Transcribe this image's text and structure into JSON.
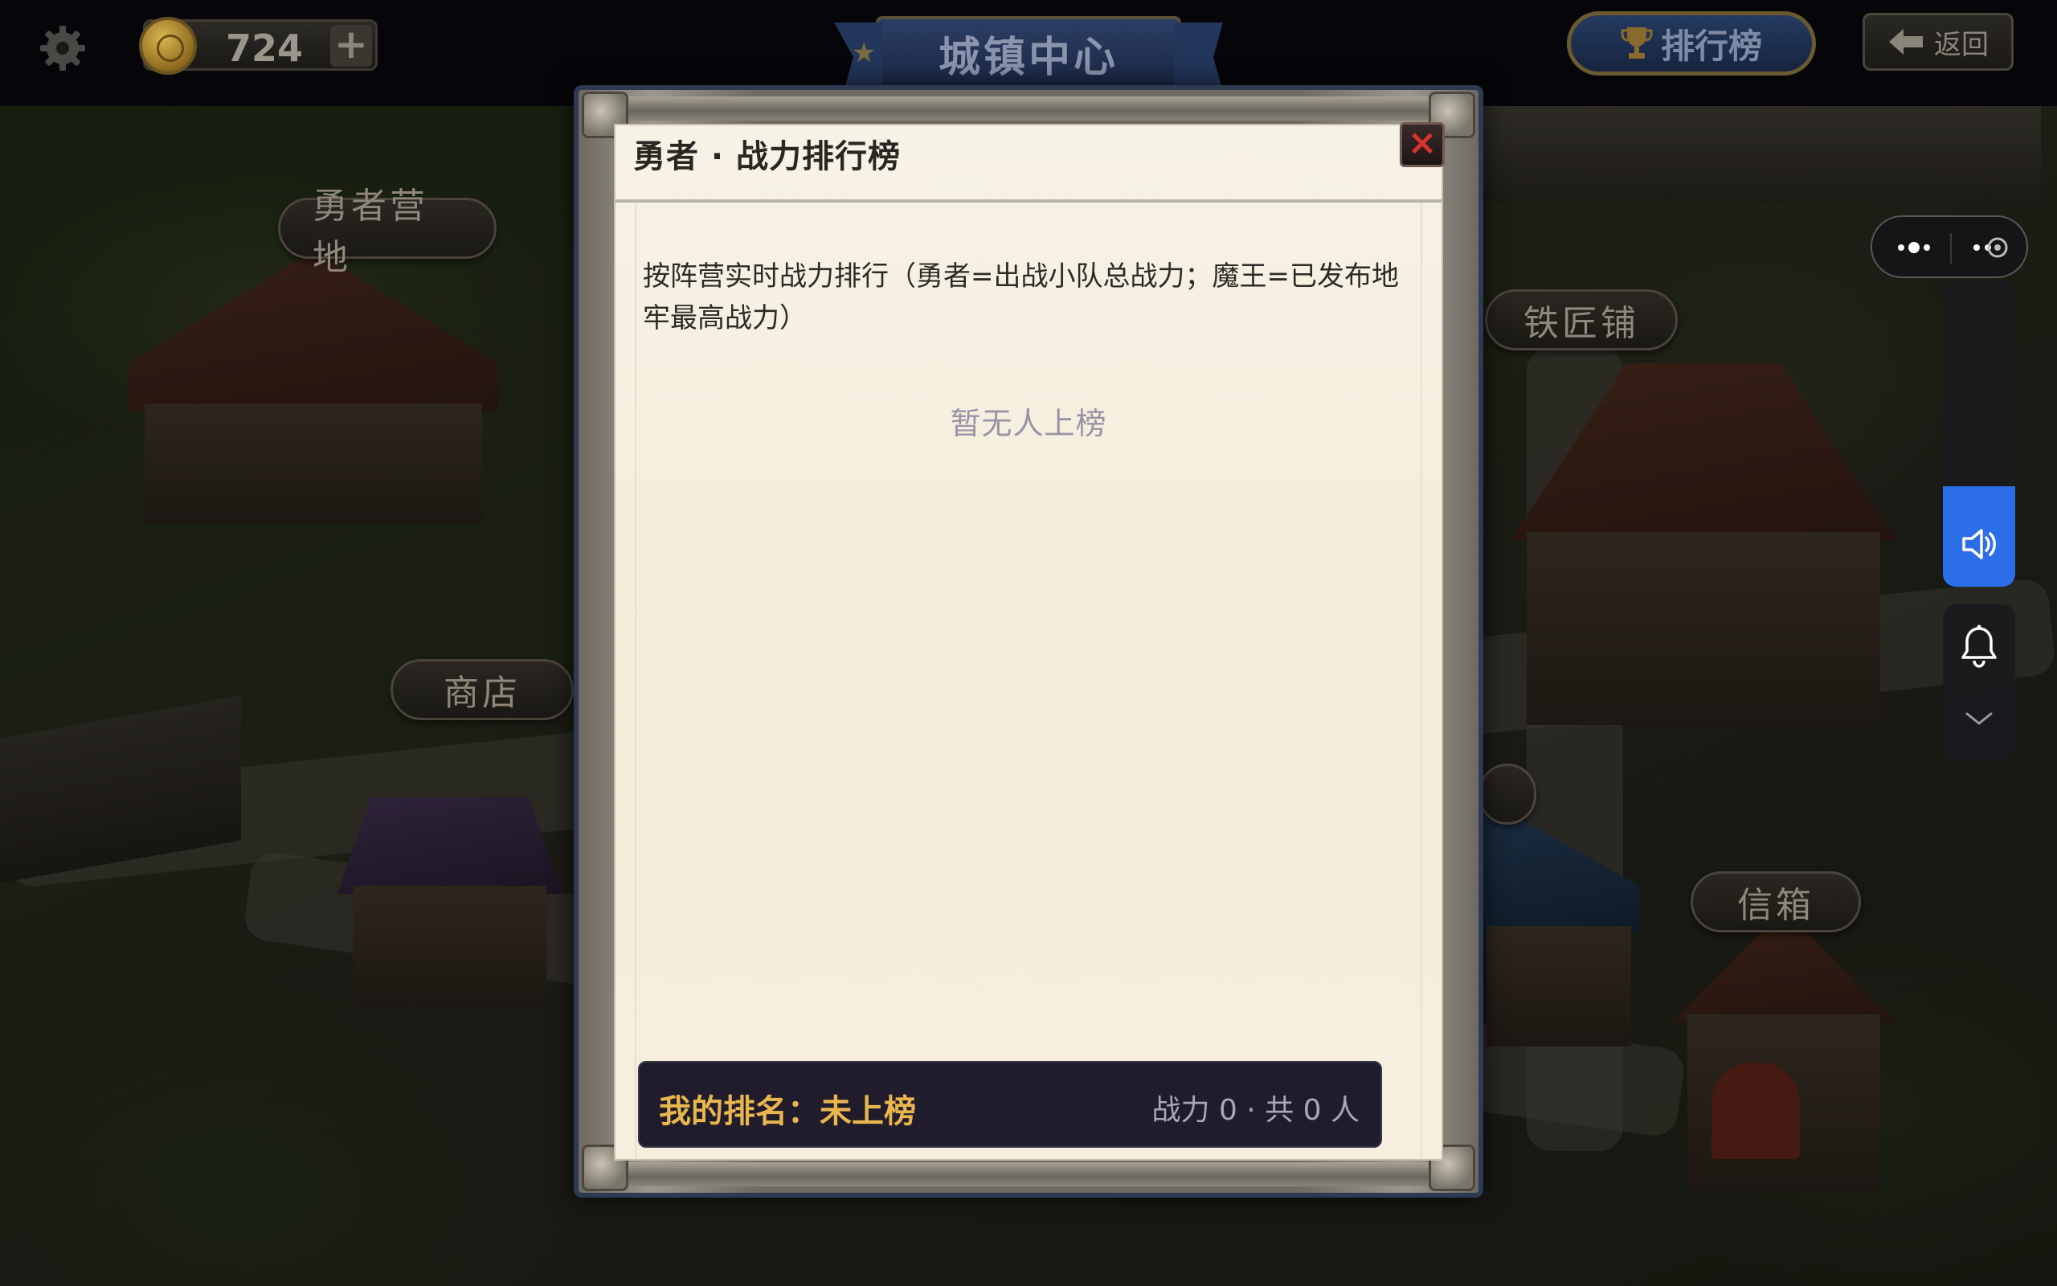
{
  "topbar": {
    "gold_amount": "724",
    "plus_symbol": "+",
    "location_title": "城镇中心",
    "ranking_button": "排行榜",
    "back_button": "返回"
  },
  "map": {
    "labels": {
      "hero_camp": "勇者营地",
      "shop": "商店",
      "blacksmith": "铁匠铺",
      "mailbox": "信箱"
    }
  },
  "modal": {
    "title": "勇者 · 战力排行榜",
    "close_symbol": "×",
    "description": "按阵营实时战力排行（勇者=出战小队总战力；魔王=已发布地牢最高战力）",
    "empty_message": "暂无人上榜",
    "my_rank_label": "我的排名：未上榜",
    "my_rank_stats": "战力 0 · 共 0 人"
  },
  "widgets": {
    "icons": [
      "more-icon",
      "close-circle-icon",
      "speaker-icon",
      "bell-icon",
      "chevron-down-icon"
    ],
    "volume_level": 0.33,
    "accent": "#2b6ee8"
  },
  "colors": {
    "gold_text": "#e8b64c",
    "close_red": "#d8342e",
    "paper": "#f6efdf",
    "rank_bar": "#211c2c"
  }
}
